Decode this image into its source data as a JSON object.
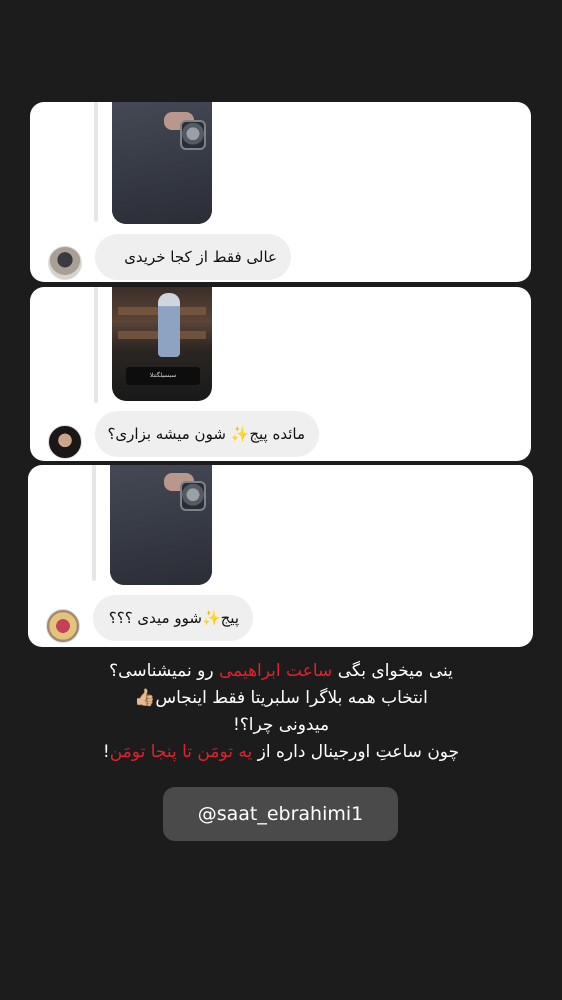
{
  "comments": [
    {
      "text": "عالی فقط از کجا خریدی"
    },
    {
      "text": "مائده پیج✨ شون میشه بزاری؟"
    },
    {
      "text": "پیج✨شوو میدی ؟؟؟"
    }
  ],
  "shop_thumbnail_label": "سبسیلگتتلا",
  "caption": {
    "line1_a": "ینی میخوای بگی ",
    "line1_red": "ساعت ابراهیمی",
    "line1_b": " رو نمیشناسی؟",
    "line2": "انتخاب همه بلاگرا سلبریتا فقط اینجاس👍🏼",
    "line3": "میدونی چرا؟!",
    "line4_a": "چون ساعتِ اورجینال داره از ",
    "line4_red": "یه تومَن تا پنجا تومَن",
    "line4_b": "!"
  },
  "handle": "@saat_ebrahimi1",
  "colors": {
    "background": "#1c1c1c",
    "accent_red": "#e0232b",
    "handle_bg": "#4a4a4a"
  }
}
